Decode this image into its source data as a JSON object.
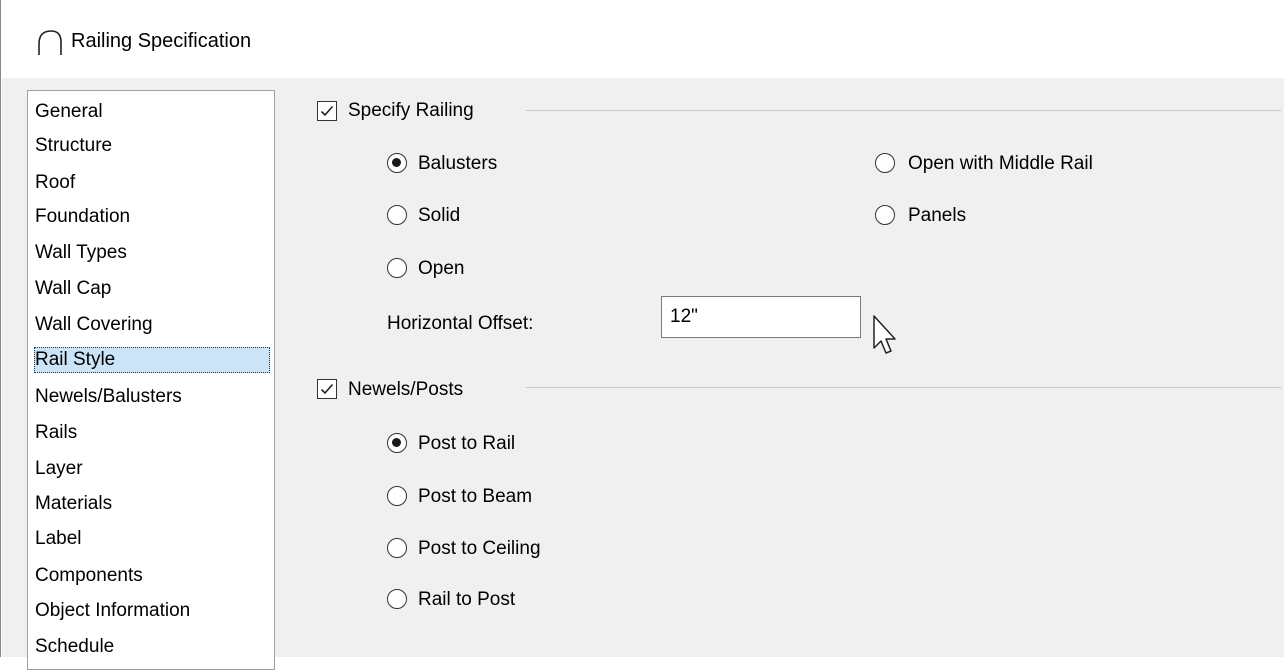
{
  "window": {
    "title": "Railing Specification"
  },
  "sidebar": {
    "items": [
      {
        "label": "General"
      },
      {
        "label": "Structure"
      },
      {
        "label": "Roof"
      },
      {
        "label": "Foundation"
      },
      {
        "label": "Wall Types"
      },
      {
        "label": "Wall Cap"
      },
      {
        "label": "Wall Covering"
      },
      {
        "label": "Rail Style",
        "selected": true
      },
      {
        "label": "Newels/Balusters"
      },
      {
        "label": "Rails"
      },
      {
        "label": "Layer"
      },
      {
        "label": "Materials"
      },
      {
        "label": "Label"
      },
      {
        "label": "Components"
      },
      {
        "label": "Object Information"
      },
      {
        "label": "Schedule"
      }
    ]
  },
  "specify_railing": {
    "label": "Specify Railing",
    "checked": true,
    "options": {
      "balusters": {
        "label": "Balusters",
        "selected": true
      },
      "solid": {
        "label": "Solid",
        "selected": false
      },
      "open": {
        "label": "Open",
        "selected": false
      },
      "open_middle_rail": {
        "label": "Open with Middle Rail",
        "selected": false
      },
      "panels": {
        "label": "Panels",
        "selected": false
      }
    },
    "horizontal_offset": {
      "label": "Horizontal Offset:",
      "value": "12\""
    }
  },
  "newels_posts": {
    "label": "Newels/Posts",
    "checked": true,
    "options": {
      "post_to_rail": {
        "label": "Post to Rail",
        "selected": true
      },
      "post_to_beam": {
        "label": "Post to Beam",
        "selected": false
      },
      "post_to_ceiling": {
        "label": "Post to Ceiling",
        "selected": false
      },
      "rail_to_post": {
        "label": "Rail to Post",
        "selected": false
      }
    }
  },
  "colors": {
    "selection": "#cce4f7",
    "dialog_bg": "#f0f0f0"
  },
  "icons": {
    "title": "arch-icon",
    "cursor": "mouse-pointer-icon"
  }
}
